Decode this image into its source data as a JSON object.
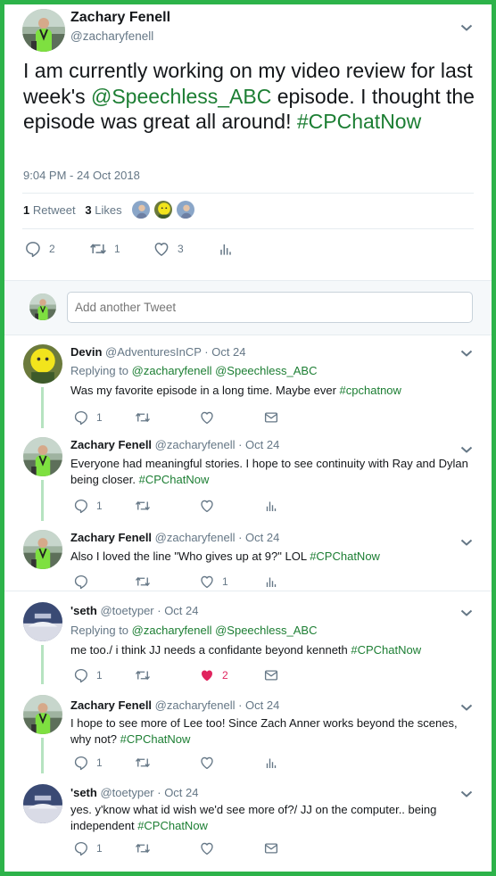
{
  "main_tweet": {
    "name": "Zachary Fenell",
    "handle": "@zacharyfenell",
    "text_before": "I am currently working on my video review for last week's ",
    "mention": "@Speechless_ABC",
    "text_after": " episode. I thought the episode was great all around! ",
    "hashtag": "#CPChatNow",
    "timestamp": "9:04 PM - 24 Oct 2018",
    "retweet_count": "1",
    "retweet_label": "Retweet",
    "like_count": "3",
    "like_label": "Likes",
    "actions": {
      "reply_count": "2",
      "retweet_count": "1",
      "like_count": "3"
    }
  },
  "composer": {
    "placeholder": "Add another Tweet"
  },
  "replies": [
    {
      "name": "Devin",
      "handle": "@AdventuresInCP",
      "date": "· Oct 24",
      "replying_label": "Replying to",
      "replying_to_1": "@zacharyfenell",
      "replying_to_2": "@Speechless_ABC",
      "text": "Was my favorite episode in a long time. Maybe ever ",
      "hashtag": "#cpchatnow",
      "reply_count": "1",
      "like_count": ""
    },
    {
      "name": "Zachary Fenell",
      "handle": "@zacharyfenell",
      "date": "· Oct 24",
      "text": "Everyone had meaningful stories. I hope to see continuity with Ray and Dylan being closer. ",
      "hashtag": "#CPChatNow",
      "reply_count": "1",
      "like_count": ""
    },
    {
      "name": "Zachary Fenell",
      "handle": "@zacharyfenell",
      "date": "· Oct 24",
      "text": "Also I loved the line \"Who gives up at 9?\" LOL ",
      "hashtag": "#CPChatNow",
      "reply_count": "",
      "like_count": "1"
    },
    {
      "name": "'seth",
      "handle": "@toetyper",
      "date": "· Oct 24",
      "replying_label": "Replying to",
      "replying_to_1": "@zacharyfenell",
      "replying_to_2": "@Speechless_ABC",
      "text": "me too./ i think JJ needs a confidante beyond kenneth ",
      "hashtag": "#CPChatNow",
      "reply_count": "1",
      "like_count": "2"
    },
    {
      "name": "Zachary Fenell",
      "handle": "@zacharyfenell",
      "date": "· Oct 24",
      "text": "I hope to see more of Lee too! Since Zach Anner works beyond the scenes, why not? ",
      "hashtag": "#CPChatNow",
      "reply_count": "1",
      "like_count": ""
    },
    {
      "name": "'seth",
      "handle": "@toetyper",
      "date": "· Oct 24",
      "text": "yes. y'know what id wish we'd see more of?/ JJ on the computer..  being independent ",
      "hashtag": "#CPChatNow",
      "reply_count": "1",
      "like_count": ""
    }
  ],
  "icons": {
    "reply": "reply-icon",
    "retweet": "retweet-icon",
    "like": "heart-icon",
    "liked": "heart-filled-icon",
    "analytics": "analytics-icon",
    "dm": "envelope-icon",
    "menu": "chevron-down-icon"
  },
  "colors": {
    "accent_green": "#1c7e33",
    "border_green": "#2db34a",
    "thread_line": "#b6e3c0",
    "like_red": "#e0245e",
    "muted": "#657786"
  }
}
